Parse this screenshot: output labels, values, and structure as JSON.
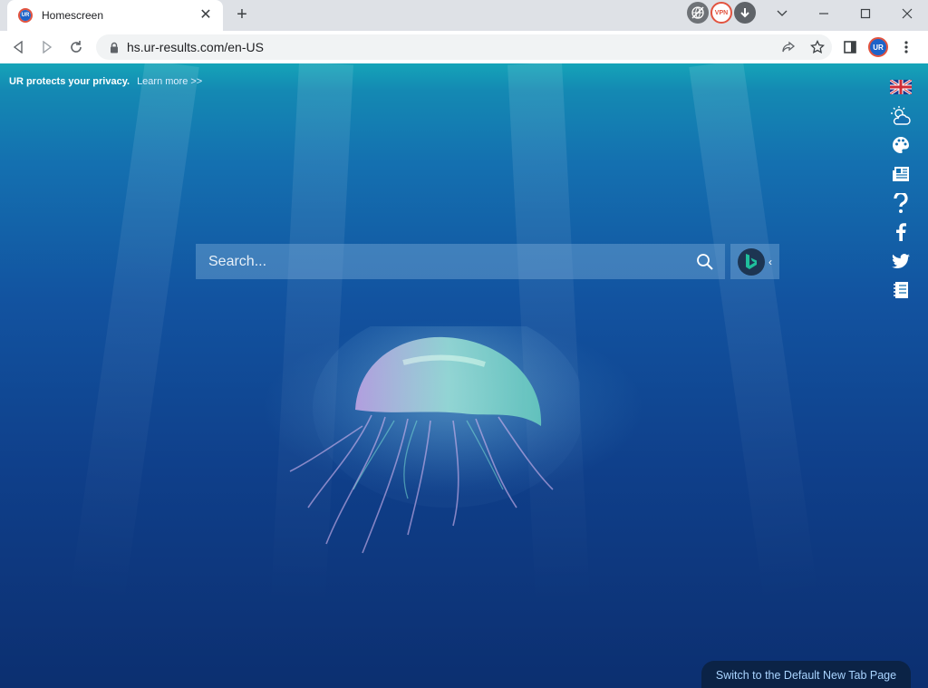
{
  "browser": {
    "tab": {
      "title": "Homescreen"
    },
    "new_tab_symbol": "+",
    "extensions": [
      {
        "icon": "globe-slash-icon"
      },
      {
        "icon": "vpn-icon",
        "label": "VPN"
      },
      {
        "icon": "download-icon"
      }
    ],
    "url": "hs.ur-results.com/en-US",
    "profile_initials": "UR",
    "accent_color": "#e2533f"
  },
  "page": {
    "privacy_text": "UR protects your privacy.",
    "learn_more": "Learn more >>",
    "search": {
      "placeholder": "Search..."
    },
    "search_engine": {
      "icon": "bing-icon"
    },
    "side_icons": [
      "uk-flag-icon",
      "weather-icon",
      "palette-icon",
      "news-icon",
      "help-icon",
      "facebook-icon",
      "twitter-icon",
      "notebook-icon"
    ],
    "switch_button": "Switch to the Default New Tab Page"
  }
}
